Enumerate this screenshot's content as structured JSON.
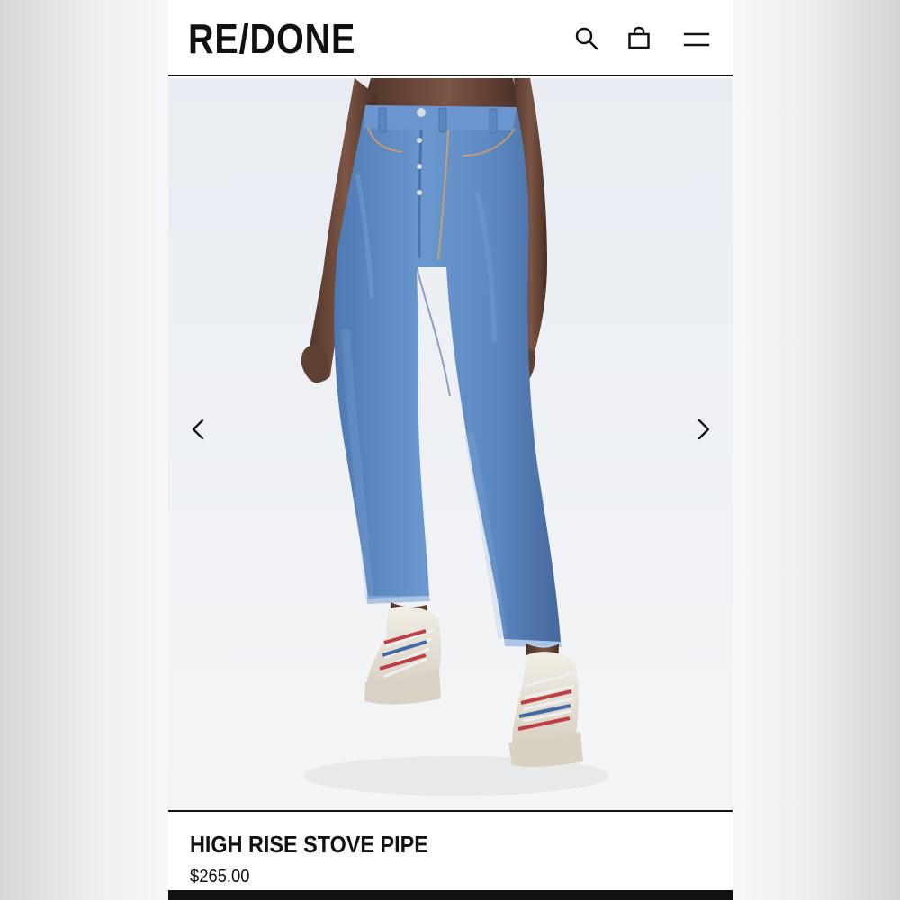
{
  "header": {
    "logo": "RE/DONE",
    "icons": {
      "search": "search-icon",
      "bag": "shopping-bag-icon",
      "menu": "menu-icon"
    }
  },
  "gallery": {
    "prev_icon": "chevron-left-icon",
    "next_icon": "chevron-right-icon"
  },
  "product": {
    "name": "HIGH RISE STOVE PIPE",
    "price": "$265.00"
  },
  "colors": {
    "text": "#111111",
    "background": "#ffffff",
    "denim": "#5f8ac2"
  }
}
